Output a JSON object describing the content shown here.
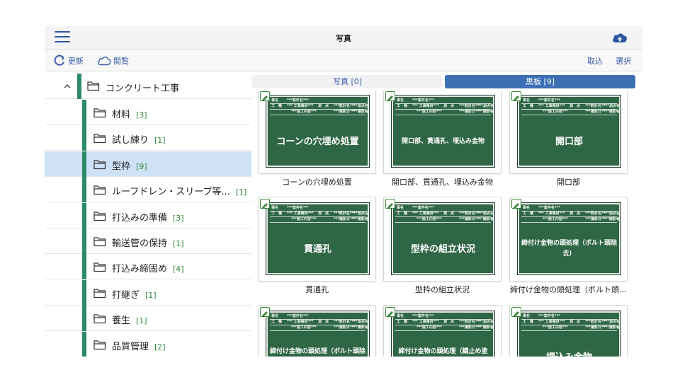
{
  "header": {
    "title": "写真"
  },
  "toolbar": {
    "refresh_label": "更新",
    "browse_label": "閲覧",
    "import_label": "取込",
    "select_label": "選択"
  },
  "sidebar": {
    "root": {
      "label": "コンクリート工事"
    },
    "items": [
      {
        "label": "材料",
        "count": "[3]"
      },
      {
        "label": "試し練り",
        "count": "[1]"
      },
      {
        "label": "型枠",
        "count": "[9]"
      },
      {
        "label": "ルーフドレン・スリーブ等...",
        "count": "[1]"
      },
      {
        "label": "打込みの準備",
        "count": "[3]"
      },
      {
        "label": "輸送管の保持",
        "count": "[1]"
      },
      {
        "label": "打込み締固め",
        "count": "[4]"
      },
      {
        "label": "打継ぎ",
        "count": "[1]"
      },
      {
        "label": "養生",
        "count": "[1]"
      },
      {
        "label": "品質管理",
        "count": "[2]"
      }
    ],
    "selected_index": 2
  },
  "tabs": [
    {
      "label": "写真 [0]",
      "active": false
    },
    {
      "label": "黒板 [9]",
      "active": true
    }
  ],
  "board_template": {
    "row1": [
      "事名",
      "***案件名***"
    ],
    "row2": [
      "工　種",
      "*** 工事種目***",
      "測　点",
      "***数計名***",
      "***測点名***"
    ],
    "row3": [
      "***施工内容***",
      "***撮影日***",
      "***撮影者***"
    ]
  },
  "cards": [
    {
      "board_text": "コーンの穴埋め処置",
      "caption": "コーンの穴埋め処置",
      "small": false
    },
    {
      "board_text": "開口部、貫通孔、埋込み金物",
      "caption": "開口部、貫通孔、埋込み金物",
      "small": true
    },
    {
      "board_text": "開口部",
      "caption": "開口部",
      "small": false
    },
    {
      "board_text": "貫通孔",
      "caption": "貫通孔",
      "small": false
    },
    {
      "board_text": "型枠の組立状況",
      "caption": "型枠の組立状況",
      "small": false
    },
    {
      "board_text": "締付け金物の頭処理（ボルト頭除去）",
      "caption": "締付け金物の頭処理（ボルト頭…",
      "small": true
    },
    {
      "board_text": "締付け金物の頭処理（ボルト頭除去、錆止め塗り）",
      "caption": "",
      "small": true
    },
    {
      "board_text": "締付け金物の頭処理（錆止め塗り）",
      "caption": "",
      "small": true
    },
    {
      "board_text": "埋込み金物",
      "caption": "",
      "small": false
    }
  ],
  "colors": {
    "accent": "#3d6fb5",
    "tree_bar": "#2a8a6a",
    "selected_row": "#cfe1f6",
    "count_text": "#2c8a3a",
    "board": "#2f6645"
  },
  "icons": {
    "menu": "hamburger-icon",
    "upload": "cloud-upload-icon",
    "refresh": "refresh-icon",
    "browse": "cloud-icon",
    "folder": "folder-icon",
    "collapse": "chevron-up-icon",
    "edit": "pen-icon"
  }
}
